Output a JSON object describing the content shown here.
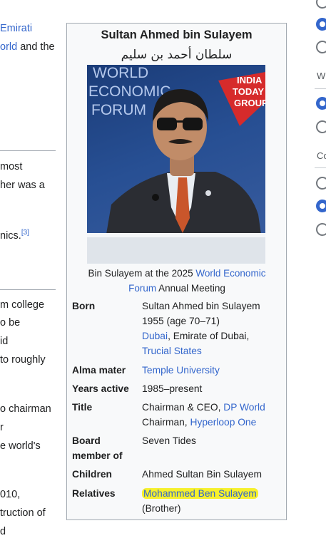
{
  "left_fragments": {
    "l1": "Emirati",
    "l2a": "orld",
    "l2b": " and the",
    "l3": "most",
    "l4": "her was a",
    "l5": "nics.",
    "l5_ref": "[3]",
    "l6": "m college",
    "l7": "o be",
    "l8": "id",
    "l9": "to roughly",
    "l10": "o chairman",
    "l11": "r",
    "l12": "e world's",
    "l13": "010,",
    "l14": "truction of",
    "l15": "d"
  },
  "infobox": {
    "title": "Sultan Ahmed bin Sulayem",
    "native_name": "سلطان أحمد بن سليم",
    "image": {
      "backdrop_text": "WORLD\nECONOMIC\nFORUM",
      "badge_text": "INDIA\nTODAY\nGROUP"
    },
    "caption": {
      "before": "Bin Sulayem at the 2025 ",
      "link": "World Economic Forum",
      "after": " Annual Meeting"
    },
    "born": {
      "label": "Born",
      "name": "Sultan Ahmed bin Sulayem",
      "year": "1955 (age 70–71)",
      "place_link": "Dubai",
      "place_rest": ", Emirate of Dubai,",
      "state_link": "Trucial States"
    },
    "alma_mater": {
      "label": "Alma mater",
      "value": "Temple University"
    },
    "years_active": {
      "label": "Years active",
      "value": "1985–present"
    },
    "title_row": {
      "label": "Title",
      "line1_text": "Chairman & CEO, ",
      "line1_link": "DP World",
      "line2_text": "Chairman, ",
      "line2_link": "Hyperloop One"
    },
    "board": {
      "label": "Board member of",
      "value": "Seven Tides"
    },
    "children": {
      "label": "Children",
      "value": "Ahmed Sultan Bin Sulayem"
    },
    "relatives": {
      "label": "Relatives",
      "link": "Mohammed Ben Sulayem",
      "note": "(Brother)"
    }
  },
  "right_panel": {
    "label_1": "Wi",
    "label_2": "Co",
    "radios": [
      false,
      true,
      false,
      true,
      false,
      false,
      true,
      false
    ]
  },
  "colors": {
    "link": "#3366cc",
    "infobox_bg": "#f8f9fa",
    "highlight": "#f6f02c"
  }
}
